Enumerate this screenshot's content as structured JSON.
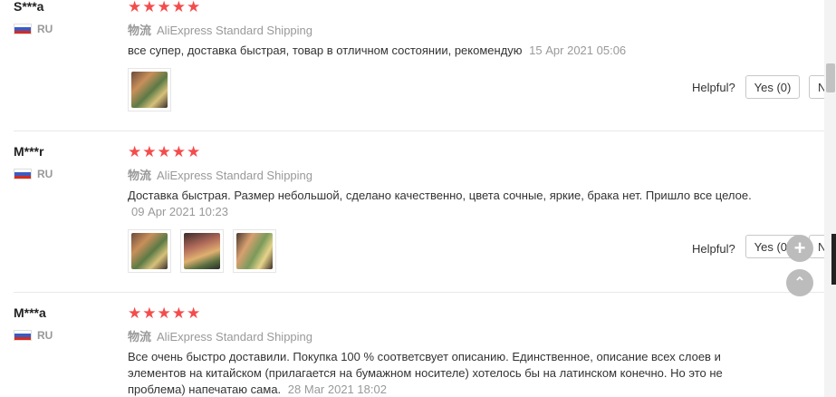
{
  "reviews": [
    {
      "user": "S***a",
      "country": "RU",
      "stars": "★★★★★",
      "shipping_prefix": "物流",
      "shipping": "AliExpress Standard Shipping",
      "text": "все супер, доставка быстрая, товар в отличном состоянии, рекомендую",
      "date": "15 Apr 2021 05:06",
      "helpful_label": "Helpful?",
      "yes_label": "Yes (0)",
      "no_label": "N"
    },
    {
      "user": "M***r",
      "country": "RU",
      "stars": "★★★★★",
      "shipping_prefix": "物流",
      "shipping": "AliExpress Standard Shipping",
      "text": "Доставка быстрая. Размер небольшой, сделано качественно, цвета сочные, яркие, брака нет. Пришло все целое.",
      "date": "09 Apr 2021 10:23",
      "helpful_label": "Helpful?",
      "yes_label": "Yes (0)",
      "no_label": "N"
    },
    {
      "user": "M***a",
      "country": "RU",
      "stars": "★★★★★",
      "shipping_prefix": "物流",
      "shipping": "AliExpress Standard Shipping",
      "text": "Все очень быстро доставили. Покупка 100 % соответсвует описанию. Единственное, описание всех слоев и элементов на китайском (прилагается на бумажном носителе) хотелось бы на латинском конечно. Но это не проблема) напечатаю сама.",
      "date": "28 Mar 2021 18:02"
    }
  ],
  "colors": {
    "stars": "#f44c4c",
    "muted": "#999999"
  },
  "icons": {
    "flag": "russia-flag-icon",
    "add": "plus-icon",
    "top": "chevron-up-icon"
  }
}
